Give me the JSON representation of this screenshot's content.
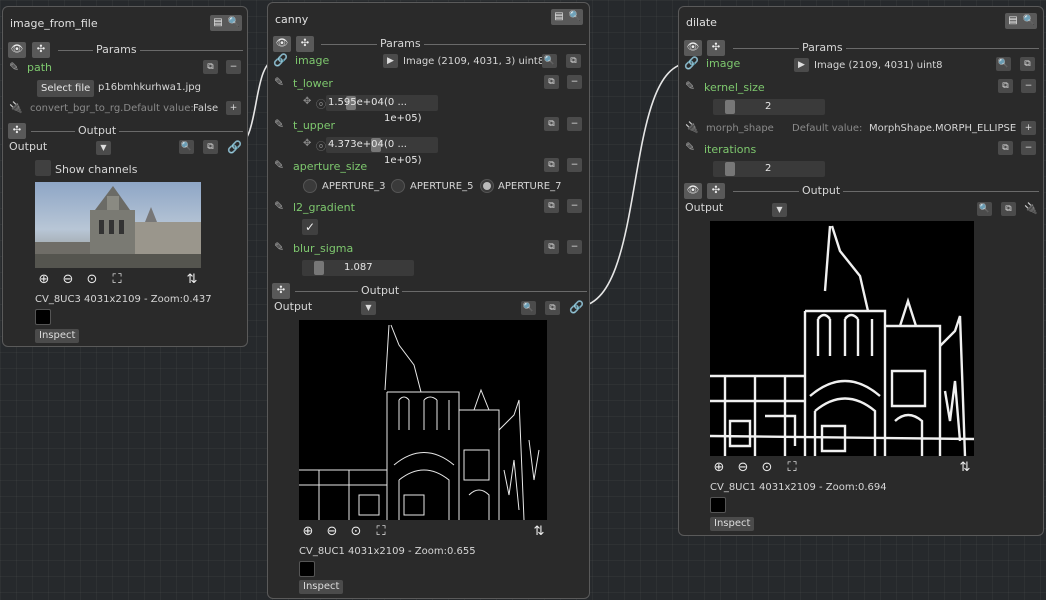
{
  "nodes": {
    "image_from_file": {
      "title": "image_from_file",
      "params_label": "Params",
      "path_label": "path",
      "select_file_label": "Select file",
      "filename": "p16bmhkurhwa1.jpg",
      "convert_label": "convert_bgr_to_rg.Default value:",
      "convert_value": "False",
      "output_label": "Output",
      "output_port": "Output",
      "show_channels_label": "Show channels",
      "image_info": "CV_8UC3 4031x2109 - Zoom:0.437",
      "inspect_label": "Inspect"
    },
    "canny": {
      "title": "canny",
      "params_label": "Params",
      "image_label": "image",
      "image_info": "Image (2109, 4031, 3) uint8",
      "t_lower_label": "t_lower",
      "t_lower_value": "1.595e+04",
      "t_lower_range": "(0 ... 1e+05)",
      "t_upper_label": "t_upper",
      "t_upper_value": "4.373e+04",
      "t_upper_range": "(0 ... 1e+05)",
      "aperture_label": "aperture_size",
      "aperture_options": [
        "APERTURE_3",
        "APERTURE_5",
        "APERTURE_7"
      ],
      "aperture_selected": "APERTURE_7",
      "l2_label": "l2_gradient",
      "blur_label": "blur_sigma",
      "blur_value": "1.087",
      "output_label": "Output",
      "output_port": "Output",
      "output_info": "CV_8UC1 4031x2109 - Zoom:0.655",
      "inspect_label": "Inspect"
    },
    "dilate": {
      "title": "dilate",
      "params_label": "Params",
      "image_label": "image",
      "image_info": "Image (2109, 4031) uint8",
      "kernel_label": "kernel_size",
      "kernel_value": "2",
      "morph_label": "morph_shape",
      "morph_default": "Default value:",
      "morph_value": "MorphShape.MORPH_ELLIPSE",
      "iterations_label": "iterations",
      "iterations_value": "2",
      "output_label": "Output",
      "output_port": "Output",
      "output_info": "CV_8UC1 4031x2109 - Zoom:0.694",
      "inspect_label": "Inspect"
    }
  },
  "colors": {
    "param_green": "#7ec86e",
    "link_blue": "#5b8ed8",
    "background": "#26292c"
  }
}
